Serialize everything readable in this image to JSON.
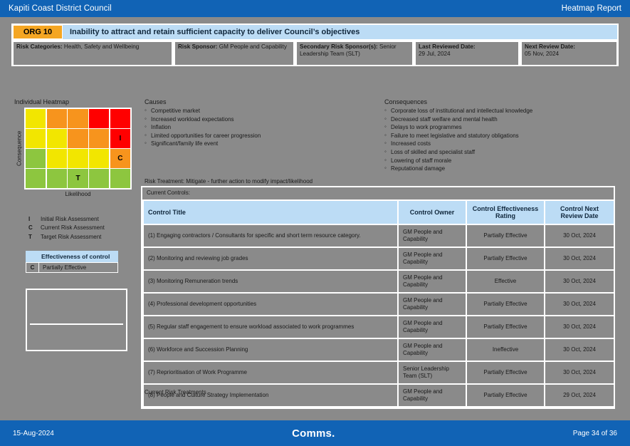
{
  "topbar": {
    "org": "Kapiti Coast District Council",
    "report": "Heatmap Report"
  },
  "risk": {
    "code": "ORG 10",
    "title": "Inability to attract and retain sufficient capacity to deliver Council’s objectives",
    "meta": [
      {
        "label": "Risk Categories:",
        "value": "Health, Safety and Wellbeing"
      },
      {
        "label": "Risk Sponsor:",
        "value": "GM People and Capability"
      },
      {
        "label": "Secondary Risk Sponsor(s):",
        "value": "Senior Leadership Team (SLT)"
      },
      {
        "label": "Last Reviewed Date:",
        "value": "29 Jul, 2024"
      },
      {
        "label": "Next Review Date:",
        "value": "05 Nov, 2024"
      }
    ]
  },
  "heatmap": {
    "title": "Individual Heatmap",
    "xlabel": "Likelihood",
    "ylabel": "Consequence",
    "colors": {
      "green": "#8DC63F",
      "yellow": "#F2E600",
      "orange": "#F7941D",
      "red": "#FF0000"
    },
    "cells": [
      [
        "yellow",
        "orange",
        "orange",
        "red",
        "red"
      ],
      [
        "yellow",
        "yellow",
        "orange",
        "orange",
        "red"
      ],
      [
        "green",
        "yellow",
        "yellow",
        "yellow",
        "orange"
      ],
      [
        "green",
        "green",
        "green",
        "green",
        "green"
      ]
    ],
    "markers": [
      {
        "row": 1,
        "col": 4,
        "label": "I"
      },
      {
        "row": 2,
        "col": 4,
        "label": "C"
      },
      {
        "row": 3,
        "col": 2,
        "label": "T"
      }
    ],
    "key": [
      {
        "k": "I",
        "label": "Initial Risk Assessment"
      },
      {
        "k": "C",
        "label": "Current Risk Assessment"
      },
      {
        "k": "T",
        "label": "Target Risk Assessment"
      }
    ],
    "effectiveness": {
      "header": "Effectiveness of control",
      "rows": [
        {
          "k": "C",
          "label": "Partially Effective"
        }
      ]
    }
  },
  "causes": {
    "heading": "Causes",
    "items": [
      "Competitive market",
      "Increased workload expectations",
      "Inflation",
      "Limited opportunities for career progression",
      "Significant/family life event"
    ]
  },
  "consequences": {
    "heading": "Consequences",
    "items": [
      "Corporate loss of institutional and intellectual knowledge",
      "Decreased staff welfare and mental health",
      "Delays to work programmes",
      "Failure to meet legislative and statutory obligations",
      "Increased costs",
      "Loss of skilled and specialist staff",
      "Lowering of staff morale",
      "Reputational damage"
    ]
  },
  "treatment": {
    "line": "Risk Treatment: Mitigate - further action to modify impact/likelihood"
  },
  "controls": {
    "panel_label": "Current Controls:",
    "columns": [
      "Control Title",
      "Control Owner",
      "Control Effectiveness Rating",
      "Control Next Review Date"
    ],
    "rows": [
      {
        "title": "(1) Engaging contractors / Consultants for specific and short term resource category.",
        "owner": "GM People and Capability",
        "rating": "Partially Effective",
        "next_review": "30 Oct, 2024"
      },
      {
        "title": "(2) Monitoring and reviewing job grades",
        "owner": "GM People and Capability",
        "rating": "Partially Effective",
        "next_review": "30 Oct, 2024"
      },
      {
        "title": "(3) Monitoring Remuneration trends",
        "owner": "GM People and Capability",
        "rating": "Effective",
        "next_review": "30 Oct, 2024"
      },
      {
        "title": "(4) Professional development opportunities",
        "owner": "GM People and Capability",
        "rating": "Partially Effective",
        "next_review": "30 Oct, 2024"
      },
      {
        "title": "(5) Regular staff engagement to ensure workload associated to work programmes",
        "owner": "GM People and Capability",
        "rating": "Partially Effective",
        "next_review": "30 Oct, 2024"
      },
      {
        "title": "(6) Workforce and Succession Planning",
        "owner": "GM People and Capability",
        "rating": "Ineffective",
        "next_review": "30 Oct, 2024"
      },
      {
        "title": "(7) Reprioritisation of Work Programme",
        "owner": "Senior Leadership Team (SLT)",
        "rating": "Partially Effective",
        "next_review": "30 Oct, 2024"
      },
      {
        "title": "(8) People and Culture Strategy Implementation",
        "owner": "GM People and Capability",
        "rating": "Partially Effective",
        "next_review": "29 Oct, 2024"
      }
    ]
  },
  "current_risk_treatments": {
    "label": "Current Risk Treatments"
  },
  "footer": {
    "date": "15-Aug-2024",
    "brand": "Comms.",
    "page": "Page 34 of 36"
  }
}
